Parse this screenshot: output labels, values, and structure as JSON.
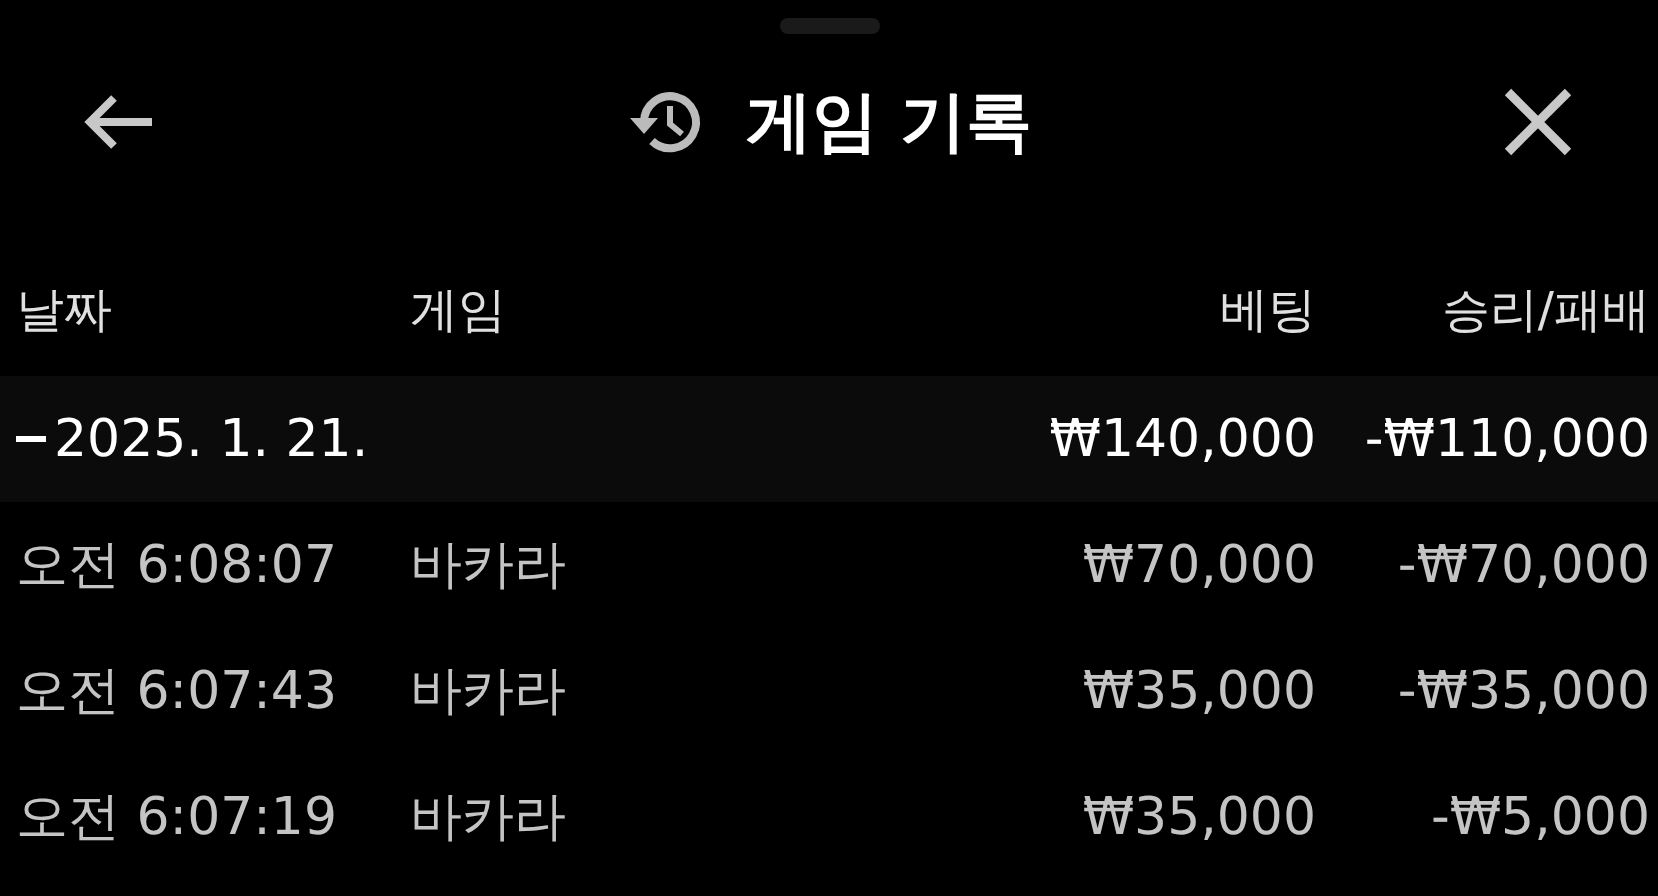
{
  "header": {
    "title": "게임 기록"
  },
  "table": {
    "columns": [
      "날짜",
      "게임",
      "베팅",
      "승리/패배"
    ],
    "groups": [
      {
        "date": "2025. 1. 21.",
        "expanded": true,
        "bet": "₩140,000",
        "result": "-₩110,000",
        "rows": [
          {
            "time": "오전 6:08:07",
            "game": "바카라",
            "bet": "₩70,000",
            "result": "-₩70,000"
          },
          {
            "time": "오전 6:07:43",
            "game": "바카라",
            "bet": "₩35,000",
            "result": "-₩35,000"
          },
          {
            "time": "오전 6:07:19",
            "game": "바카라",
            "bet": "₩35,000",
            "result": "-₩5,000"
          }
        ]
      }
    ]
  }
}
